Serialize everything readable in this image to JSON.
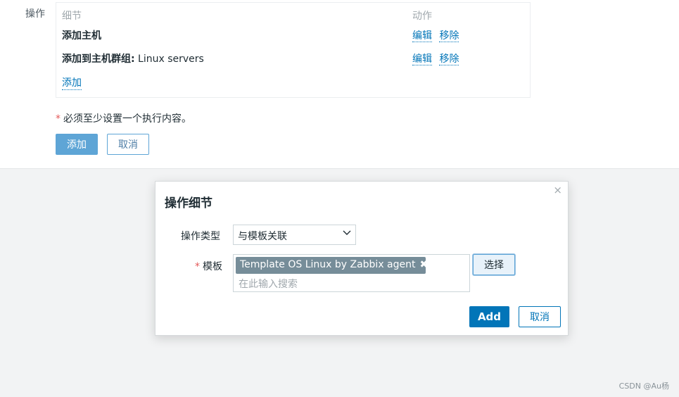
{
  "operations": {
    "label": "操作",
    "headers": {
      "detail": "细节",
      "action": "动作"
    },
    "rows": [
      {
        "bold": "添加主机",
        "rest": "",
        "edit": "编辑",
        "remove": "移除"
      },
      {
        "bold": "添加到主机群组:",
        "rest": " Linux servers",
        "edit": "编辑",
        "remove": "移除"
      }
    ],
    "add_link": "添加"
  },
  "required_note": {
    "star": "*",
    "text": "必须至少设置一个执行内容。"
  },
  "form_buttons": {
    "add": "添加",
    "cancel": "取消"
  },
  "modal": {
    "title": "操作细节",
    "close": "×",
    "type_label": "操作类型",
    "type_value": "与模板关联",
    "template_label": "模板",
    "template_star": "*",
    "template_tag": "Template OS Linux by Zabbix agent",
    "tag_remove": "✖",
    "search_placeholder": "在此输入搜索",
    "select_button": "选择",
    "add_button": "Add",
    "cancel_button": "取消"
  },
  "watermark": "CSDN @Au杨",
  "colors": {
    "link": "#0275b8",
    "primary": "#0275b8",
    "tag": "#768d99",
    "required": "#e45959"
  }
}
